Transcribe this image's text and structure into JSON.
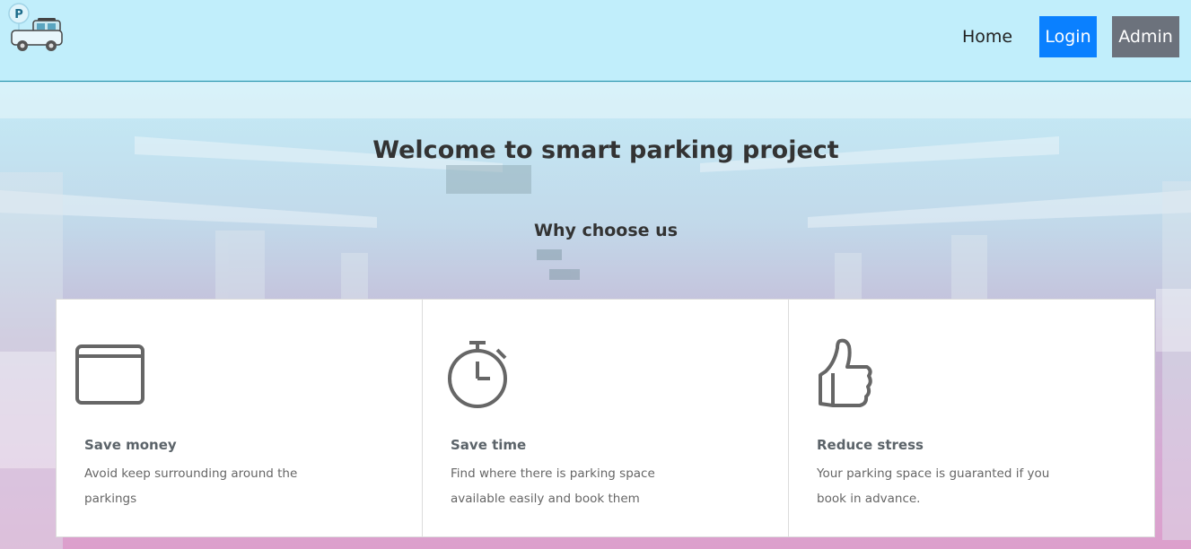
{
  "nav": {
    "home_label": "Home",
    "login_label": "Login",
    "admin_label": "Admin",
    "logo_letter": "P",
    "logo_icon": "parking-car-logo"
  },
  "hero": {
    "title": "Welcome to smart parking project",
    "subtitle": "Why choose us"
  },
  "features": [
    {
      "icon": "wallet-icon",
      "title": "Save money",
      "text": "Avoid keep surrounding around the parkings"
    },
    {
      "icon": "stopwatch-icon",
      "title": "Save time",
      "text": "Find where there is parking space available easily and book them"
    },
    {
      "icon": "thumbs-up-icon",
      "title": "Reduce stress",
      "text": "Your parking space is guaranted if you book in advance."
    }
  ],
  "colors": {
    "navbar_bg": "#c1eefb",
    "login_bg": "#0a80ff",
    "admin_bg": "#6c727c",
    "icon_gray": "#666666"
  }
}
